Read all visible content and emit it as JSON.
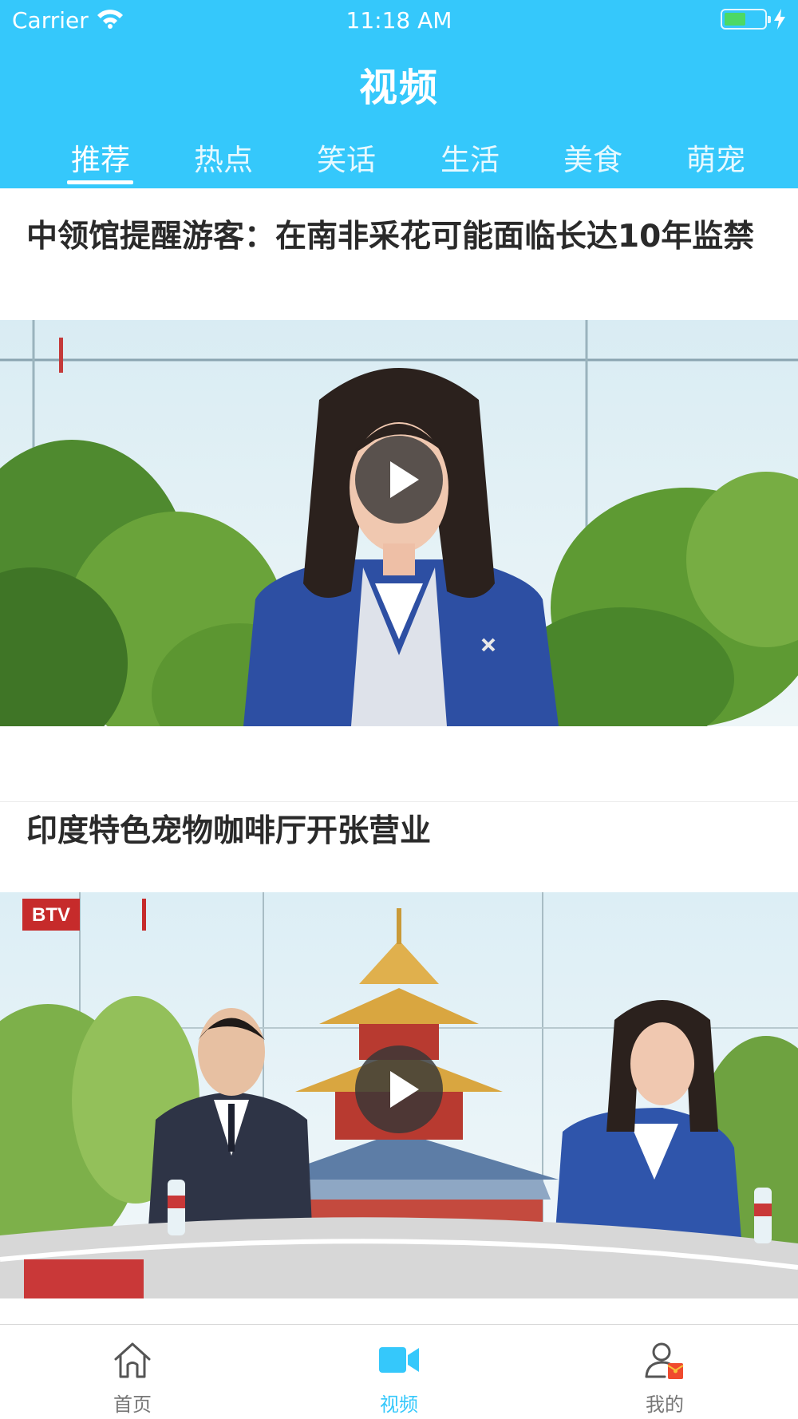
{
  "status_bar": {
    "carrier": "Carrier",
    "time": "11:18 AM"
  },
  "nav": {
    "title": "视频"
  },
  "category_tabs": [
    {
      "label": "推荐",
      "active": true
    },
    {
      "label": "热点",
      "active": false
    },
    {
      "label": "笑话",
      "active": false
    },
    {
      "label": "生活",
      "active": false
    },
    {
      "label": "美食",
      "active": false
    },
    {
      "label": "萌宠",
      "active": false
    }
  ],
  "feed": [
    {
      "title": "中领馆提醒游客：在南非采花可能面临长达10年监禁",
      "thumbnail_icon": "news-anchor-thumbnail"
    },
    {
      "title": "印度特色宠物咖啡厅开张营业",
      "thumbnail_icon": "news-studio-thumbnail",
      "channel_logo": "BTV"
    }
  ],
  "tabbar": [
    {
      "label": "首页",
      "icon": "home-icon",
      "active": false
    },
    {
      "label": "视频",
      "icon": "video-camera-icon",
      "active": true
    },
    {
      "label": "我的",
      "icon": "profile-icon",
      "active": false
    }
  ],
  "colors": {
    "accent": "#35c8fb",
    "title_text": "#2a2a2a",
    "inactive_tab": "#777777",
    "battery": "#4cd964"
  }
}
